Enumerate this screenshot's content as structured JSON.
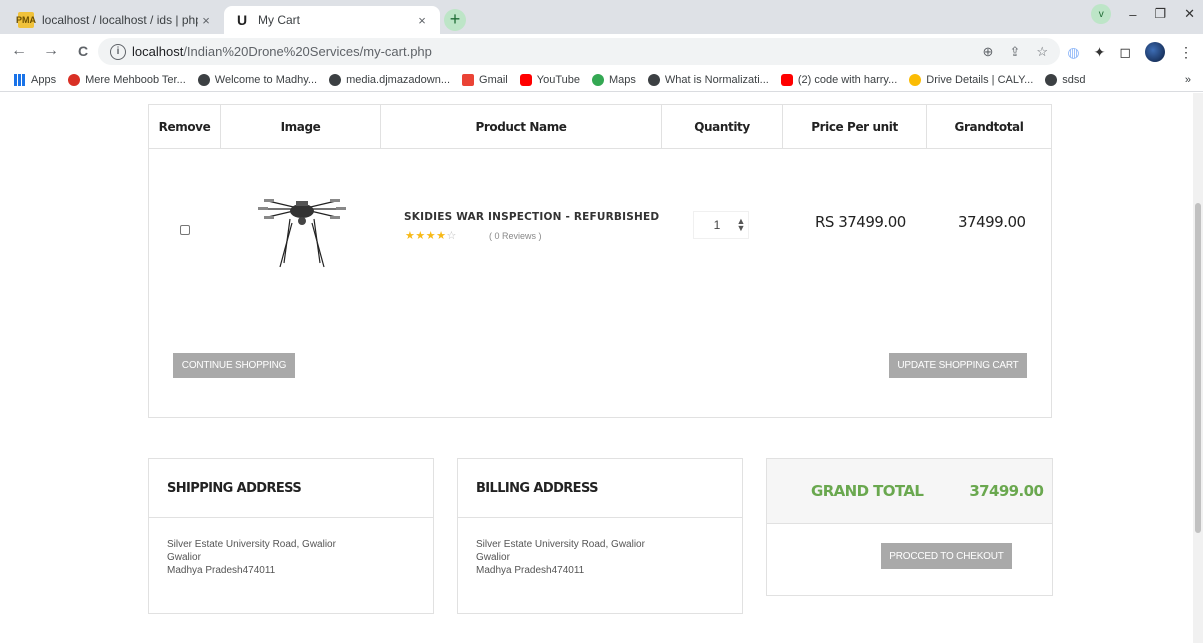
{
  "browser": {
    "tabs": [
      {
        "title": "localhost / localhost / ids | phpM",
        "favicon": "phpmyadmin-icon",
        "favicon_text": "PMA",
        "close": "×"
      },
      {
        "title": "My Cart",
        "favicon": "site-icon",
        "favicon_text": "U",
        "close": "×"
      }
    ],
    "new_tab": "+",
    "profile_badge": "v",
    "window_controls": {
      "minimize": "–",
      "restore": "❐",
      "close": "✕"
    },
    "nav": {
      "back": "←",
      "forward": "→",
      "reload": "C"
    },
    "url": {
      "info": "i",
      "host": "localhost",
      "path": "/Indian%20Drone%20Services/my-cart.php"
    },
    "omni_icons": [
      "⊕",
      "⇪",
      "☆"
    ],
    "extensions": [
      "◍",
      "✦",
      "◻"
    ],
    "bookmarks": [
      {
        "label": "Apps",
        "icon": "grid"
      },
      {
        "label": "Mere Mehboob Ter...",
        "icon": "red"
      },
      {
        "label": "Welcome to Madhy...",
        "icon": "dark"
      },
      {
        "label": "media.djmazadown...",
        "icon": "dark"
      },
      {
        "label": "Gmail",
        "icon": "mail"
      },
      {
        "label": "YouTube",
        "icon": "yt"
      },
      {
        "label": "Maps",
        "icon": "maps"
      },
      {
        "label": "What is Normalizati...",
        "icon": "dark"
      },
      {
        "label": "(2) code with harry...",
        "icon": "yt"
      },
      {
        "label": "Drive Details | CALY...",
        "icon": "drive"
      },
      {
        "label": "sdsd",
        "icon": "dark"
      }
    ],
    "bookmarks_more": "»"
  },
  "cart": {
    "headers": [
      "Remove",
      "Image",
      "Product Name",
      "Quantity",
      "Price Per unit",
      "Grandtotal"
    ],
    "item": {
      "name": "SKIDIES WAR INSPECTION - REFURBISHED",
      "stars_filled": "★★★★",
      "stars_empty": "☆",
      "rating": 4,
      "reviews": "( 0 Reviews )",
      "quantity": "1",
      "price": "RS 37499.00",
      "grandtotal": "37499.00"
    },
    "continue_button": "CONTINUE SHOPPING",
    "update_button": "UPDATE SHOPPING CART"
  },
  "shipping": {
    "title": "SHIPPING ADDRESS",
    "line1": "Silver Estate University Road, Gwalior",
    "line2": "Gwalior",
    "line3": "Madhya Pradesh474011"
  },
  "billing": {
    "title": "BILLING ADDRESS",
    "line1": "Silver Estate University Road, Gwalior",
    "line2": "Gwalior",
    "line3": "Madhya Pradesh474011"
  },
  "summary": {
    "label": "GRAND TOTAL",
    "amount": "37499.00",
    "checkout_button": "PROCCED TO CHEKOUT"
  },
  "colors": {
    "accent_green": "#6aa84f",
    "button_gray": "#a9a9a9"
  }
}
